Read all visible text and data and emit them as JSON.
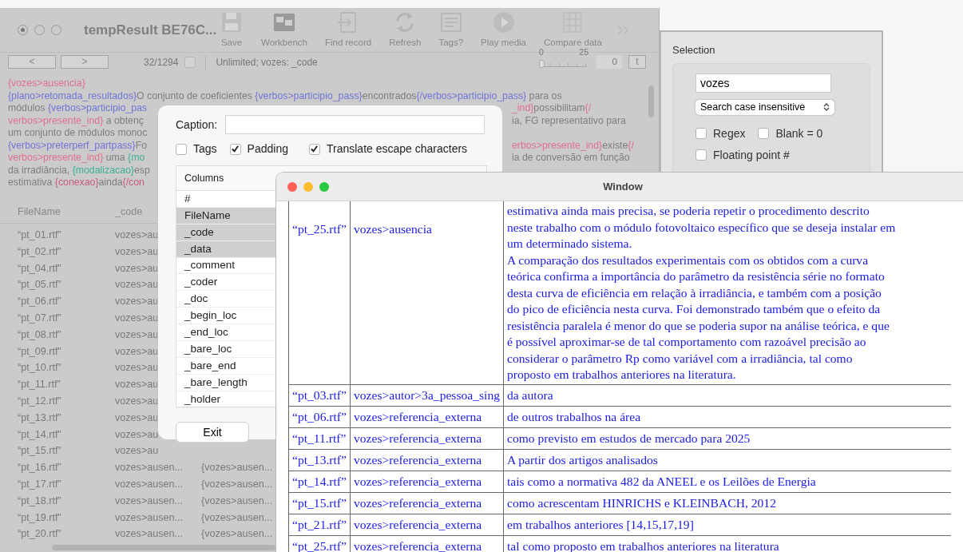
{
  "main_window": {
    "title": "tempResult BE76C...",
    "toolbar": [
      {
        "label": "Save"
      },
      {
        "label": "Workbench"
      },
      {
        "label": "Find record"
      },
      {
        "label": "Refresh"
      },
      {
        "label": "Tags?"
      },
      {
        "label": "Play media"
      },
      {
        "label": "Compare data"
      }
    ],
    "nav": {
      "back": "<",
      "forward": ">",
      "record": "32/1294",
      "record_checked": false,
      "filter": "Unlimited; vozes: _code",
      "slider_min": "0",
      "slider_max": "25",
      "level": 0,
      "value": "0",
      "t_button": "t"
    },
    "coded_text": [
      {
        "left": [
          {
            "text": "{vozes>ausencia}",
            "color": "#e0708f"
          }
        ]
      },
      {
        "left": [
          {
            "text": "{plano>retomada_resultados}",
            "color": "#7474d8"
          },
          {
            "text": "O conjunto de coeficientes "
          },
          {
            "text": "{verbos>participio_pass}",
            "color": "#7474d8"
          },
          {
            "text": "encontrados"
          },
          {
            "text": "{/verbos>participio_pass}",
            "color": "#7474d8"
          },
          {
            "text": " para os"
          }
        ]
      },
      {
        "left": [
          {
            "text": "módulos "
          },
          {
            "text": "{verbos>participio_pas",
            "color": "#7474d8"
          }
        ],
        "right": [
          {
            "text": "_ind}",
            "color": "#e0708f"
          },
          {
            "text": "possibilitam"
          },
          {
            "text": "{/",
            "color": "#e0708f"
          }
        ]
      },
      {
        "left": [
          {
            "text": "verbos>presente_ind}",
            "color": "#e0708f"
          },
          {
            "text": " a obtenç"
          }
        ],
        "right": [
          {
            "text": "ia, FG representativo para"
          }
        ]
      },
      {
        "left": [
          {
            "text": "um conjunto de módulos monoc"
          }
        ]
      },
      {
        "left": [
          {
            "text": "{verbos>preterperf_partpass}",
            "color": "#7474d8"
          },
          {
            "text": "Fo"
          }
        ],
        "right": [
          {
            "text": "erbos>presente_ind}",
            "color": "#e0708f"
          },
          {
            "text": "existe"
          },
          {
            "text": "{/",
            "color": "#e0708f"
          }
        ]
      },
      {
        "left": [
          {
            "text": "verbos>presente_ind}",
            "color": "#e0708f"
          },
          {
            "text": " uma "
          },
          {
            "text": "{mo",
            "color": "#3fae95"
          }
        ],
        "right": [
          {
            "text": "ia de conversão em função"
          }
        ]
      },
      {
        "left": [
          {
            "text": "da irradiância, "
          },
          {
            "text": "{modalizacao}",
            "color": "#3fae95"
          },
          {
            "text": "esp"
          }
        ]
      },
      {
        "left": [
          {
            "text": "estimativa "
          },
          {
            "text": "{conexao}",
            "color": "#c85a80"
          },
          {
            "text": "ainda"
          },
          {
            "text": "{/con",
            "color": "#c85a80"
          }
        ]
      }
    ],
    "table": {
      "columns": [
        "FileName",
        "_code"
      ],
      "rows": [
        {
          "file": "“pt_01.rtf”",
          "code": "vozes>au"
        },
        {
          "file": "“pt_02.rtf”",
          "code": "vozes>au"
        },
        {
          "file": "“pt_04.rtf”",
          "code": "vozes>au"
        },
        {
          "file": "“pt_05.rtf”",
          "code": "vozes>au"
        },
        {
          "file": "“pt_06.rtf”",
          "code": "vozes>au"
        },
        {
          "file": "“pt_07.rtf”",
          "code": "vozes>au"
        },
        {
          "file": "“pt_08.rtf”",
          "code": "vozes>au"
        },
        {
          "file": "“pt_09.rtf”",
          "code": "vozes>au"
        },
        {
          "file": "“pt_10.rtf”",
          "code": "vozes>au"
        },
        {
          "file": "“pt_11.rtf”",
          "code": "vozes>au"
        },
        {
          "file": "“pt_12.rtf”",
          "code": "vozes>au"
        },
        {
          "file": "“pt_13.rtf”",
          "code": "vozes>au"
        },
        {
          "file": "“pt_14.rtf”",
          "code": "vozes>au"
        },
        {
          "file": "“pt_15.rtf”",
          "code": "vozes>au"
        },
        {
          "file": "“pt_16.rtf”",
          "code": "vozes>ausen...",
          "column_3": "{vozes>ausen..."
        },
        {
          "file": "“pt_17.rtf”",
          "code": "vozes>ausen...",
          "column_3": "{vozes>ausen..."
        },
        {
          "file": "“pt_18.rtf”",
          "code": "vozes>ausen...",
          "column_3": "{vozes>ausen..."
        },
        {
          "file": "“pt_19.rtf”",
          "code": "vozes>ausen...",
          "column_3": "{vozes>ausen..."
        },
        {
          "file": "“pt_20.rtf”",
          "code": "vozes>ausen...",
          "column_3": "{vozes>ausen..."
        }
      ]
    }
  },
  "export_dialog": {
    "caption_label": "Caption:",
    "options": [
      {
        "label": "Tags",
        "checked": false
      },
      {
        "label": "Padding",
        "checked": true
      },
      {
        "label": "Translate escape characters",
        "checked": true
      }
    ],
    "columns_header": "Columns",
    "columns": [
      {
        "label": "#",
        "selected": false
      },
      {
        "label": "FileName",
        "selected": true
      },
      {
        "label": "_code",
        "selected": true
      },
      {
        "label": "_data",
        "selected": true
      },
      {
        "label": "_comment",
        "selected": false
      },
      {
        "label": "_coder",
        "selected": false
      },
      {
        "label": "_doc",
        "selected": false
      },
      {
        "label": "_begin_loc",
        "selected": false
      },
      {
        "label": "_end_loc",
        "selected": false
      },
      {
        "label": "_bare_loc",
        "selected": false
      },
      {
        "label": "_bare_end",
        "selected": false
      },
      {
        "label": "_bare_length",
        "selected": false
      },
      {
        "label": "_holder",
        "selected": false
      }
    ],
    "exit_button": "Exit"
  },
  "selection_panel": {
    "title": "Selection",
    "search_value": "vozes",
    "mode": "Search case insensitive",
    "options": [
      {
        "label": "Regex",
        "checked": false
      },
      {
        "label": "Blank = 0",
        "checked": false
      },
      {
        "label": "Floating point #",
        "checked": false
      }
    ]
  },
  "result_window": {
    "title": "Window",
    "rows": [
      {
        "file": "“pt_25.rtf”",
        "code": "vozes>ausencia",
        "lines": [
          "estimativa ainda mais precisa, se poderia repetir o procedimento descrito",
          "neste trabalho com o módulo fotovoltaico específico que se deseja instalar em",
          "um determinado sistema.",
          "A comparação dos resultados experimentais com os obtidos com a curva",
          "teórica confirma a importância do parâmetro da resistência série no formato",
          "desta curva de eficiência em relação à irradiância, e também com a posição",
          "do pico de eficiência nesta curva. Foi demonstrado também que o efeito da",
          "resistência paralela é menor do que se poderia supor na análise teórica, e que",
          "é possível aproximar-se de tal comportamento com razoável precisão ao",
          "considerar o parâmetro Rp como variável com a irradiância, tal como",
          "proposto em trabalhos anteriores na literatura."
        ]
      },
      {
        "file": "“pt_03.rtf”",
        "code": "vozes>autor>3a_pessoa_sing",
        "lines": [
          "da autora"
        ]
      },
      {
        "file": "“pt_06.rtf”",
        "code": "vozes>referencia_externa",
        "lines": [
          "de outros trabalhos na área"
        ]
      },
      {
        "file": "“pt_11.rtf”",
        "code": "vozes>referencia_externa",
        "lines": [
          "como previsto em estudos de mercado para 2025"
        ]
      },
      {
        "file": "“pt_13.rtf”",
        "code": "vozes>referencia_externa",
        "lines": [
          "A partir dos artigos analisados"
        ]
      },
      {
        "file": "“pt_14.rtf”",
        "code": "vozes>referencia_externa",
        "lines": [
          "tais como a normativa 482 da ANEEL e os Leilões de Energia"
        ]
      },
      {
        "file": "“pt_15.rtf”",
        "code": "vozes>referencia_externa",
        "lines": [
          "como acrescentam HINRICHS e KLEINBACH, 2012"
        ]
      },
      {
        "file": "“pt_21.rtf”",
        "code": "vozes>referencia_externa",
        "lines": [
          "em trabalhos anteriores [14,15,17,19]"
        ]
      },
      {
        "file": "“pt_25.rtf”",
        "code": "vozes>referencia_externa",
        "lines": [
          "tal como proposto em trabalhos anteriores na literatura"
        ]
      }
    ]
  }
}
